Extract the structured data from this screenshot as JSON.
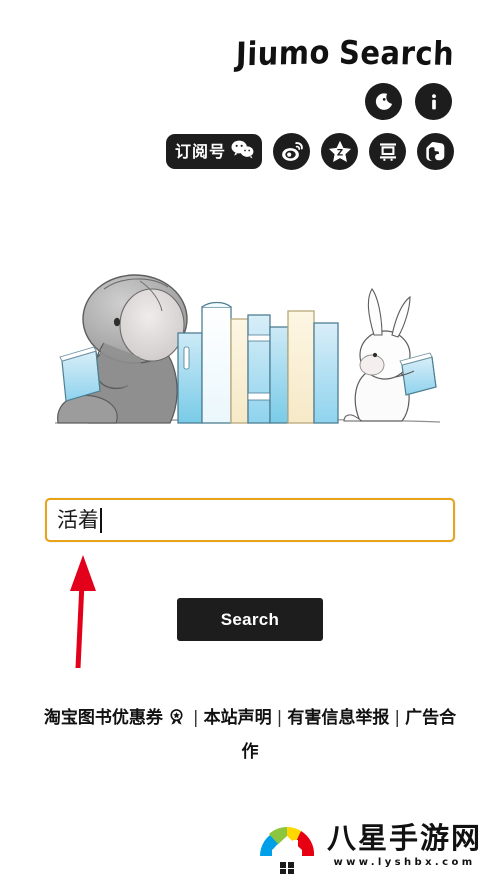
{
  "header": {
    "brand_word1": "Jiumo",
    "brand_word2": "Search",
    "icons": [
      {
        "name": "moon-icon",
        "label": "Night mode"
      },
      {
        "name": "info-icon",
        "label": "About"
      }
    ],
    "social": [
      {
        "name": "wechat-subscription-pill",
        "label": "订阅号"
      },
      {
        "name": "weibo-icon",
        "label": "Weibo"
      },
      {
        "name": "qzone-star-icon",
        "label": "QZone"
      },
      {
        "name": "douban-icon",
        "label": "豆"
      },
      {
        "name": "evernote-icon",
        "label": "Evernote"
      }
    ]
  },
  "illustration": {
    "alt": "Elephant and rabbit reading books"
  },
  "search": {
    "value": "活着",
    "placeholder": "",
    "button_label": "Search",
    "border_color": "#e8a317"
  },
  "annotation": {
    "arrow_color": "#e2001a",
    "points_to": "search-input"
  },
  "footer": {
    "links": [
      {
        "label": "淘宝图书优惠券",
        "icon": "award-badge-icon"
      },
      {
        "label": "本站声明"
      },
      {
        "label": "有害信息举报"
      },
      {
        "label": "广告合作"
      }
    ],
    "separator": "|"
  },
  "watermark": {
    "title": "八星手游网",
    "url": "www.lyshbx.com",
    "colors": [
      "#00a0e9",
      "#8cc63f",
      "#ffd800",
      "#e60012"
    ]
  }
}
